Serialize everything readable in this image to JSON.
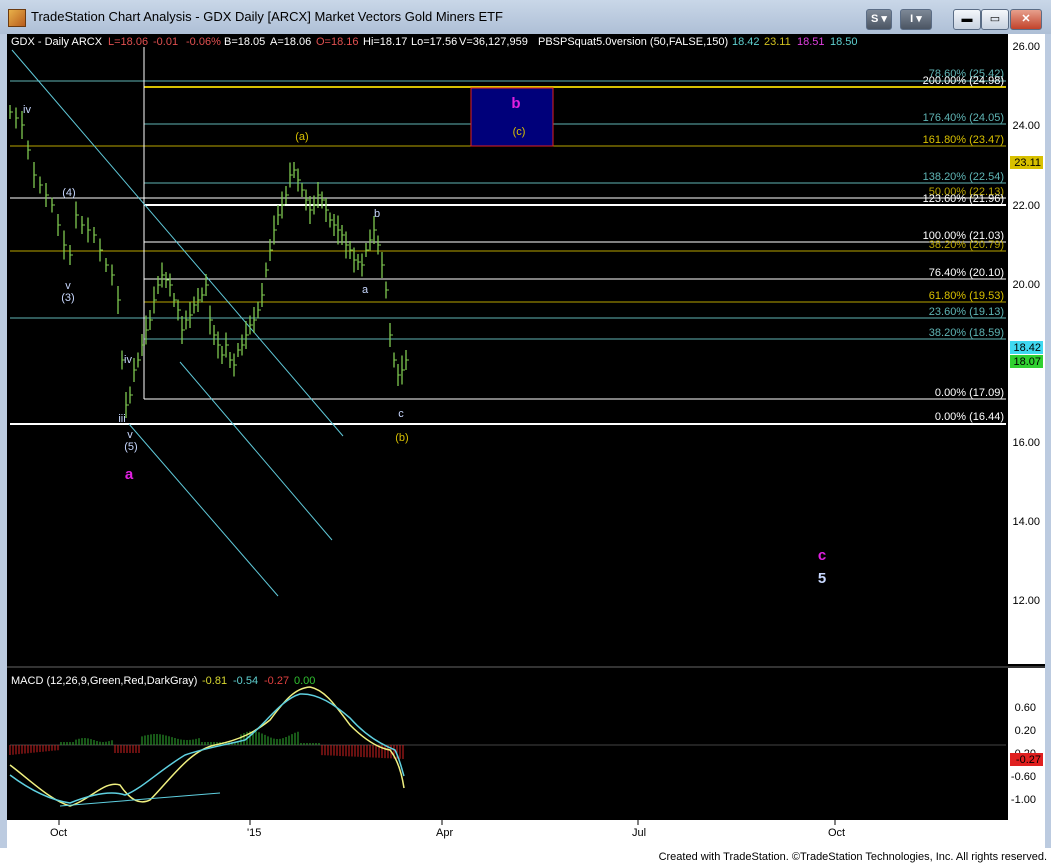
{
  "window": {
    "title": "TradeStation Chart Analysis - GDX Daily [ARCX] Market Vectors Gold Miners ETF",
    "s_button": "S",
    "i_button": "I"
  },
  "header": {
    "symbol": "GDX - Daily  ARCX",
    "last": "L=18.06",
    "change": "-0.01",
    "pct": "-0.06%",
    "bid": "B=18.05",
    "ask": "A=18.06",
    "open": "O=18.16",
    "hi": "Hi=18.17",
    "lo": "Lo=17.56",
    "vol": "V=36,127,959",
    "study": "PBSPSquat5.0version (50,FALSE,150)",
    "v1": "18.42",
    "v2": "23.11",
    "v3": "18.51",
    "v4": "18.50"
  },
  "price_axis": {
    "ticks": [
      "26.00",
      "24.00",
      "22.00",
      "20.00",
      "18.00",
      "16.00",
      "14.00",
      "12.00"
    ],
    "tag_23": "23.11",
    "tag_1842": "18.42",
    "tag_1807": "18.07"
  },
  "fib_labels": [
    "78.60% (25.42)",
    "200.00% (24.98)",
    "176.40% (24.05)",
    "161.80% (23.47)",
    "138.20% (22.54)",
    "50.00% (22.13)",
    "123.60% (21.96)",
    "100.00% (21.03)",
    "38.20% (20.79)",
    "76.40% (20.10)",
    "61.80% (19.53)",
    "23.60% (19.13)",
    "38.20% (18.59)",
    "0.00% (17.09)",
    "0.00% (16.44)"
  ],
  "wave_labels": {
    "b_big": "b",
    "c_small": "(c)",
    "a_paren": "(a)",
    "iv_top": "iv",
    "four": "(4)",
    "v_small": "v",
    "three": "(3)",
    "iv2": "iv",
    "iii": "iii",
    "v2": "v",
    "five": "(5)",
    "a_big": "a",
    "b_small": "b",
    "a_small": "a",
    "c_small2": "c",
    "b_paren": "(b)",
    "c_big": "c",
    "five_big": "5"
  },
  "macd": {
    "label": "MACD (12,26,9,Green,Red,DarkGray)",
    "val1": "-0.81",
    "val2": "-0.54",
    "val3": "-0.27",
    "val4": "0.00",
    "ticks": [
      "0.60",
      "0.20",
      "-0.20",
      "-0.60",
      "-1.00"
    ],
    "tag": "-0.27"
  },
  "time_axis": [
    "Oct",
    "'15",
    "Apr",
    "Jul",
    "Oct"
  ],
  "footer": "Created with TradeStation. ©TradeStation Technologies, Inc. All rights reserved.",
  "colors": {
    "bar_green": "#7ec850",
    "fib_cyan": "#5fb5b5",
    "fib_yellow": "#b8a400",
    "magenta": "#e020e0",
    "navy_box": "#00007a",
    "axis_bg": "#ffffff"
  }
}
